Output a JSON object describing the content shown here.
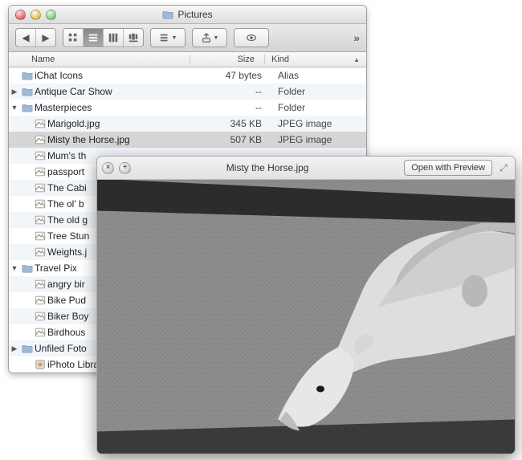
{
  "finder": {
    "title": "Pictures",
    "columns": {
      "name": "Name",
      "size": "Size",
      "kind": "Kind"
    },
    "rows": [
      {
        "indent": 0,
        "disclosure": "",
        "icon": "folder",
        "name": "iChat Icons",
        "size": "47 bytes",
        "kind": "Alias",
        "alt": false
      },
      {
        "indent": 0,
        "disclosure": "▶",
        "icon": "folder",
        "name": "Antique Car Show",
        "size": "--",
        "kind": "Folder",
        "alt": true
      },
      {
        "indent": 0,
        "disclosure": "▼",
        "icon": "folder",
        "name": "Masterpieces",
        "size": "--",
        "kind": "Folder",
        "alt": false
      },
      {
        "indent": 1,
        "disclosure": "",
        "icon": "image",
        "name": "Marigold.jpg",
        "size": "345 KB",
        "kind": "JPEG image",
        "alt": true
      },
      {
        "indent": 1,
        "disclosure": "",
        "icon": "image",
        "name": "Misty the Horse.jpg",
        "size": "507 KB",
        "kind": "JPEG image",
        "alt": false,
        "selected": true
      },
      {
        "indent": 1,
        "disclosure": "",
        "icon": "image",
        "name": "Mum's th",
        "size": "",
        "kind": "",
        "alt": true
      },
      {
        "indent": 1,
        "disclosure": "",
        "icon": "image",
        "name": "passport",
        "size": "",
        "kind": "",
        "alt": false
      },
      {
        "indent": 1,
        "disclosure": "",
        "icon": "image",
        "name": "The Cabi",
        "size": "",
        "kind": "",
        "alt": true
      },
      {
        "indent": 1,
        "disclosure": "",
        "icon": "image",
        "name": "The ol' b",
        "size": "",
        "kind": "",
        "alt": false
      },
      {
        "indent": 1,
        "disclosure": "",
        "icon": "image",
        "name": "The old g",
        "size": "",
        "kind": "",
        "alt": true
      },
      {
        "indent": 1,
        "disclosure": "",
        "icon": "image",
        "name": "Tree Stun",
        "size": "",
        "kind": "",
        "alt": false
      },
      {
        "indent": 1,
        "disclosure": "",
        "icon": "image",
        "name": "Weights.j",
        "size": "",
        "kind": "",
        "alt": true
      },
      {
        "indent": 0,
        "disclosure": "▼",
        "icon": "folder",
        "name": "Travel Pix",
        "size": "",
        "kind": "",
        "alt": false
      },
      {
        "indent": 1,
        "disclosure": "",
        "icon": "image",
        "name": "angry bir",
        "size": "",
        "kind": "",
        "alt": true
      },
      {
        "indent": 1,
        "disclosure": "",
        "icon": "image",
        "name": "Bike Pud",
        "size": "",
        "kind": "",
        "alt": false
      },
      {
        "indent": 1,
        "disclosure": "",
        "icon": "image",
        "name": "Biker Boy",
        "size": "",
        "kind": "",
        "alt": true
      },
      {
        "indent": 1,
        "disclosure": "",
        "icon": "image",
        "name": "Birdhous",
        "size": "",
        "kind": "",
        "alt": false
      },
      {
        "indent": 0,
        "disclosure": "▶",
        "icon": "folder",
        "name": "Unfiled Foto",
        "size": "",
        "kind": "",
        "alt": true
      },
      {
        "indent": 1,
        "disclosure": "",
        "icon": "app",
        "name": "iPhoto Libra",
        "size": "",
        "kind": "",
        "alt": false
      }
    ]
  },
  "quicklook": {
    "title": "Misty the Horse.jpg",
    "open_label": "Open with Preview"
  }
}
